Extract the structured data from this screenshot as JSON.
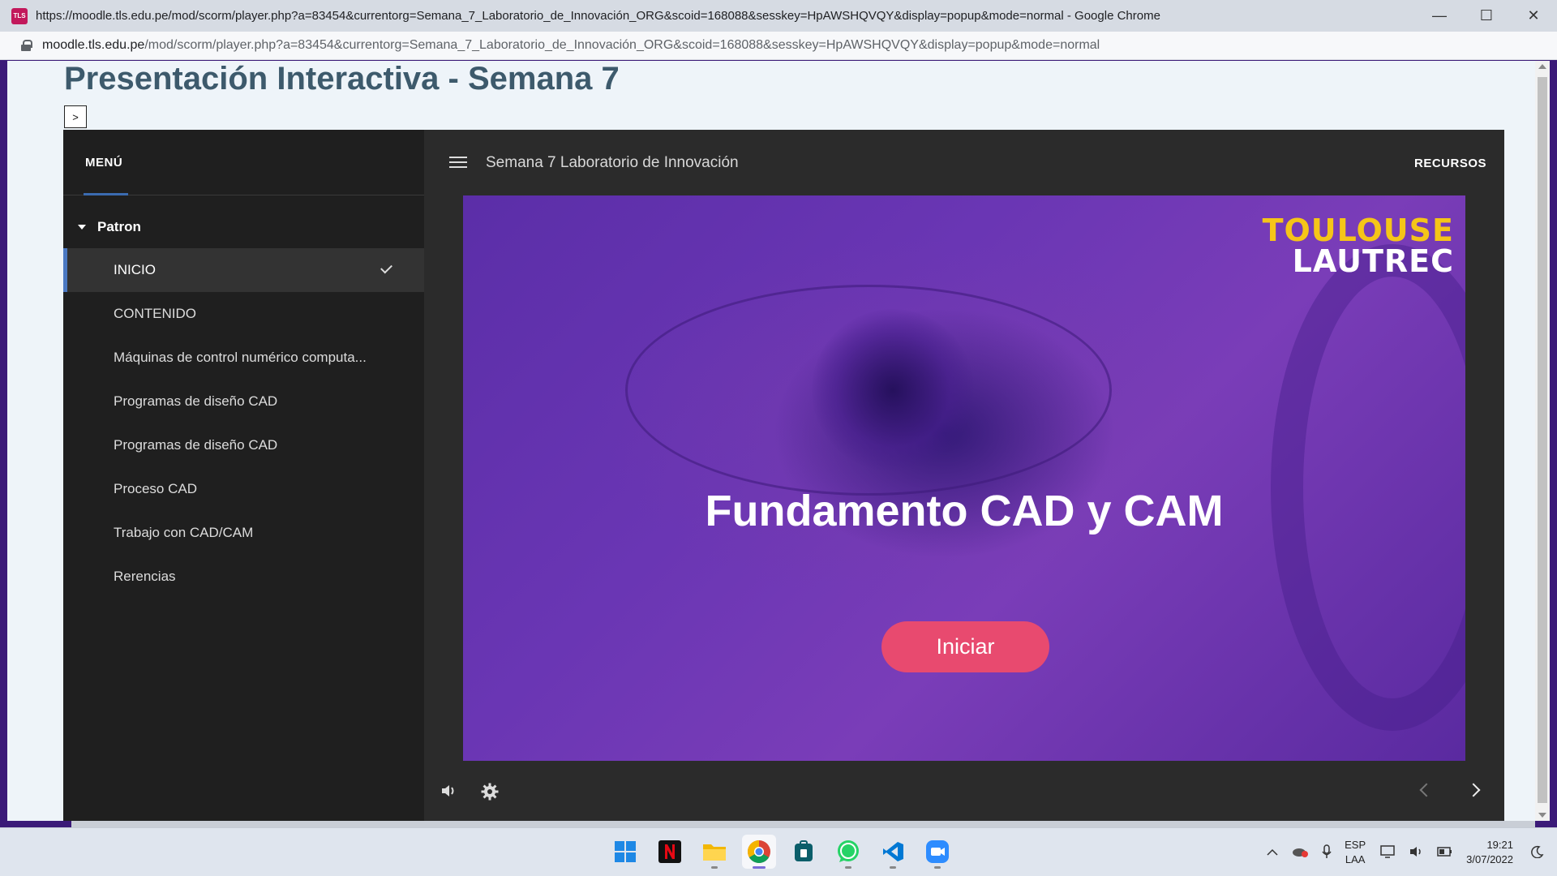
{
  "window": {
    "title": "https://moodle.tls.edu.pe/mod/scorm/player.php?a=83454&currentorg=Semana_7_Laboratorio_de_Innovación_ORG&scoid=168088&sesskey=HpAWSHQVQY&display=popup&mode=normal - Google Chrome",
    "favicon_text": "TLS",
    "minimize": "—",
    "maximize": "☐",
    "close": "✕"
  },
  "address": {
    "host": "moodle.tls.edu.pe",
    "path": "/mod/scorm/player.php?a=83454&currentorg=Semana_7_Laboratorio_de_Innovación_ORG&scoid=168088&sesskey=HpAWSHQVQY&display=popup&mode=normal"
  },
  "page": {
    "title": "Presentación Interactiva - Semana 7",
    "toggle_label": ">"
  },
  "sidebar": {
    "menu_tab": "MENÚ",
    "group": "Patron",
    "items": [
      {
        "label": "INICIO"
      },
      {
        "label": "CONTENIDO"
      },
      {
        "label": "Máquinas de control numérico computa..."
      },
      {
        "label": "Programas de diseño CAD"
      },
      {
        "label": "Programas de diseño CAD"
      },
      {
        "label": "Proceso CAD"
      },
      {
        "label": "Trabajo con CAD/CAM"
      },
      {
        "label": "Rerencias"
      }
    ]
  },
  "topbar": {
    "course_title": "Semana 7 Laboratorio de Innovación",
    "resources": "RECURSOS"
  },
  "slide": {
    "logo_line1": "TOULOUSE",
    "logo_line2": "LAUTREC",
    "heading": "Fundamento CAD y CAM",
    "start_button": "Iniciar"
  },
  "taskbar": {
    "apps": [
      "windows-start",
      "netflix",
      "file-explorer",
      "chrome",
      "app-store",
      "whatsapp",
      "vscode",
      "zoom"
    ],
    "lang_line1": "ESP",
    "lang_line2": "LAA",
    "time": "19:21",
    "date": "3/07/2022"
  },
  "colors": {
    "accent_blue": "#4a78c2",
    "start_button": "#e84a6f",
    "logo_yellow": "#f5c518",
    "page_title": "#3d5a6c"
  }
}
